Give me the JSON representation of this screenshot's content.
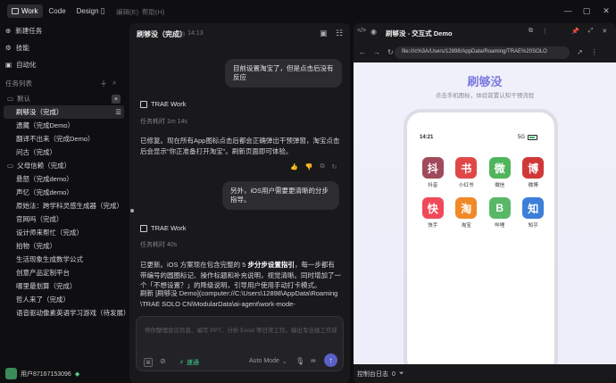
{
  "top": {
    "tabs": [
      "Work",
      "Code",
      "Design"
    ],
    "menus": [
      "编辑(E)",
      "帮助(H)"
    ]
  },
  "sidebar": {
    "new_task": "新建任务",
    "skills": "技能",
    "automation": "自动化",
    "task_list": "任务列表",
    "group_default": "默认",
    "tasks_default": [
      "刷够没（完成）",
      "遗藏（完成Demo）",
      "翻译不出来（完成Demo）",
      "问古（完成）"
    ],
    "group_parent": "父母信赖（完成）",
    "tasks_more": [
      "悬怒（完成demo）",
      "声忆（完成demo）",
      "原始法：跨学科灵感生成器（完成）",
      "官网吗（完成）",
      "设计师来帮忙（完成）",
      "拍物（完成）",
      "生活现象生成数学公式",
      "创意产品定制平台",
      "哪里最划算（完成）",
      "哲人来了（完成）",
      "语音驱动像素英语学习游戏（待发展）"
    ],
    "user": "用户87167153096"
  },
  "chat": {
    "title": "刷够没（完成）",
    "time": "14:13",
    "msg1": "目前设置淘宝了，但是点击后没有反应",
    "agent": "TRAE Work",
    "dur1": "任务耗时 1m 14s",
    "reply1": "已修复。现在所有App图标点击后都会正确弹出干预弹窗，淘宝点击后会显示\"你正准备打开淘宝\"。刷新页面即可体验。",
    "msg2": "另外，iOS用户需要更清晰的分步指导。",
    "dur2": "任务耗时 40s",
    "reply2_pre": "已更新。iOS 方案现在包含完整的 5 ",
    "reply2_bold": "步分步设置指引",
    "reply2_post": "，每一步都有带编号的圆圈标记、操作标题和补充说明，视觉清晰。同时增加了一个「不想设置？」的降级说明，引导用户使用手动打卡模式。",
    "reply2_link": "刷新 [刷够没 Demo](computer://C:\\Users\\12898\\AppData\\Roaming\\TRAE SOLO CN\\ModularData\\ai-agent\\work-mode-",
    "input_placeholder": "帮你整理会议信息、编写 PPT、分析 Excel 等日常工作，输出专业级工作成果。",
    "speed": "速通",
    "mode": "Auto Mode"
  },
  "preview": {
    "title": "刷够没 - 交互式 Demo",
    "url": "file:///c%3A/Users/12898/AppData/Roaming/TRAE%20SOLO",
    "app_title": "刷够没",
    "app_sub": "点击手机图标，体验前置认知干预流程",
    "phone_time": "14:21",
    "signal": "5G",
    "apps": [
      {
        "g": "抖",
        "n": "抖音",
        "c": "#a04a5c"
      },
      {
        "g": "书",
        "n": "小红书",
        "c": "#e04848"
      },
      {
        "g": "微",
        "n": "微信",
        "c": "#4fb55a"
      },
      {
        "g": "博",
        "n": "微博",
        "c": "#d03838"
      },
      {
        "g": "快",
        "n": "快手",
        "c": "#f04a5a"
      },
      {
        "g": "淘",
        "n": "淘宝",
        "c": "#f08a28"
      },
      {
        "g": "B",
        "n": "哔哩",
        "c": "#58b868"
      },
      {
        "g": "知",
        "n": "知乎",
        "c": "#3d7fd8"
      }
    ],
    "console": "控制台日志",
    "console_count": "0"
  }
}
